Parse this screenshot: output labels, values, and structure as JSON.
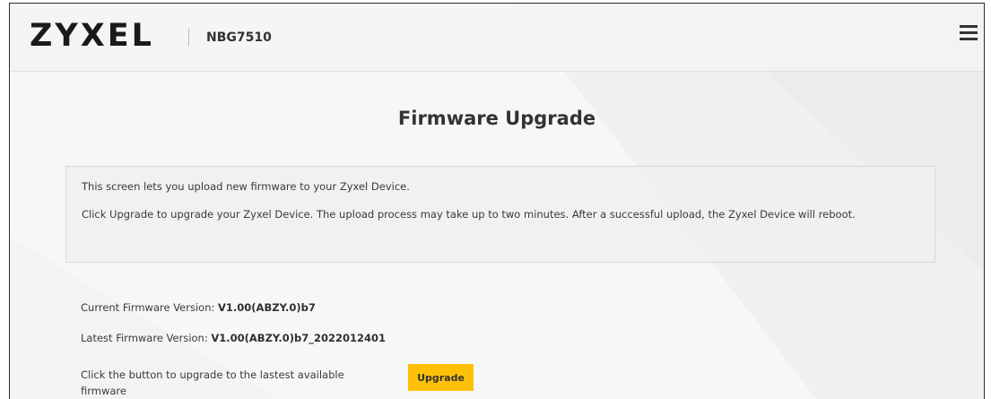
{
  "header": {
    "logo": "ZYXEL",
    "model": "NBG7510",
    "menu_icon": "hamburger-menu-icon"
  },
  "main": {
    "title": "Firmware Upgrade",
    "notice": {
      "line1": "This screen lets you upload new firmware to your Zyxel Device.",
      "line2": "Click Upgrade to upgrade your Zyxel Device. The upload process may take up to two minutes. After a successful upload, the Zyxel Device will reboot."
    },
    "current_firmware": {
      "label": "Current Firmware Version:",
      "value": "V1.00(ABZY.0)b7"
    },
    "latest_firmware": {
      "label": "Latest Firmware Version:",
      "value": "V1.00(ABZY.0)b7_2022012401"
    },
    "upgrade": {
      "text": "Click the button to upgrade to the lastest available firmware",
      "button_label": "Upgrade"
    }
  },
  "colors": {
    "accent": "#ffc107",
    "background": "#f7f7f7",
    "text": "#333333"
  }
}
